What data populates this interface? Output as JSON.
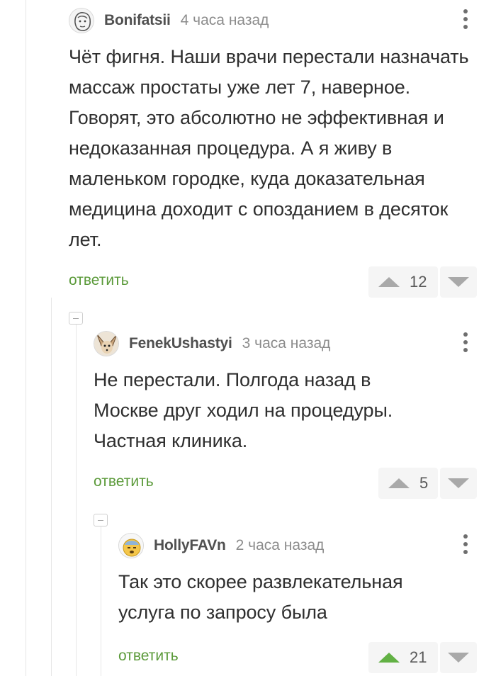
{
  "comments": [
    {
      "username": "Bonifatsii",
      "time": "4 часа назад",
      "text": "Чёт фигня. Наши врачи перестали назначать массаж простаты уже лет 7, наверное. Говорят, это абсолютно не эффективная и недоказанная процедура. А я живу в маленьком городке, куда доказательная медицина доходит с опозданием в десяток лет.",
      "reply_label": "ответить",
      "score": "12",
      "upvoted": false,
      "avatar_icon": "user-avatar-sketch"
    },
    {
      "username": "FenekUshastyi",
      "time": "3 часа назад",
      "text": "Не перестали. Полгода назад в Москве друг ходил на процедуры. Частная клиника.",
      "reply_label": "ответить",
      "score": "5",
      "upvoted": false,
      "avatar_icon": "fennec-fox-avatar"
    },
    {
      "username": "HollyFAVn",
      "time": "2 часа назад",
      "text": "Так это скорее развлекательная услуга по запросу была",
      "reply_label": "ответить",
      "score": "21",
      "upvoted": true,
      "avatar_icon": "emoji-face-avatar"
    }
  ],
  "colors": {
    "reply_green": "#5b9a3a",
    "upvote_active": "#62b144",
    "vote_inactive": "#a9a9a9",
    "thread_line": "#e6e6e6"
  }
}
